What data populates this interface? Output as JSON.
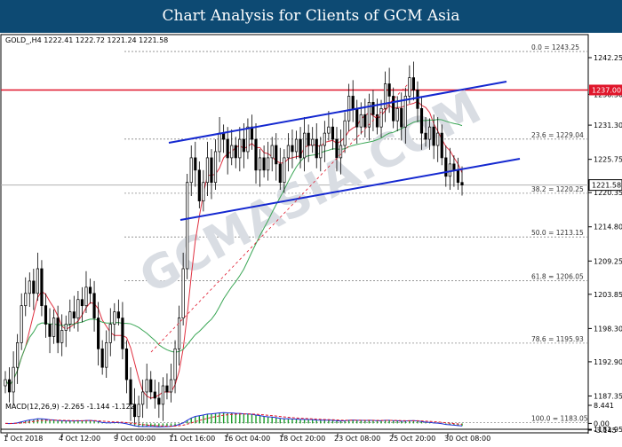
{
  "title": "Chart Analysis for Clients of GCM Asia",
  "chart_data": [
    {
      "type": "candlestick",
      "symbol_line": "GOLD_,H4  1222.41 1222.72 1221.24 1221.58",
      "y_ticks": [
        "1242.25",
        "1236.30",
        "1231.30",
        "1225.75",
        "1220.35",
        "1214.80",
        "1209.25",
        "1203.85",
        "1198.30",
        "1192.90",
        "1187.35",
        "1181.95"
      ],
      "y_values": [
        1242.25,
        1236.3,
        1231.3,
        1225.75,
        1220.35,
        1214.8,
        1209.25,
        1203.85,
        1198.3,
        1192.9,
        1187.35,
        1181.95
      ],
      "x_ticks": [
        "1 Oct 2018",
        "4 Oct 12:00",
        "9 Oct 00:00",
        "11 Oct 16:00",
        "16 Oct 04:00",
        "18 Oct 20:00",
        "23 Oct 08:00",
        "25 Oct 20:00",
        "30 Oct 08:00"
      ],
      "current_price": "1221.58",
      "resistance_level": "1237.00",
      "fibonacci": [
        {
          "label": "0.0 = 1243.25",
          "value": 1243.25
        },
        {
          "label": "23.6 = 1229.04",
          "value": 1229.04
        },
        {
          "label": "38.2 = 1220.25",
          "value": 1220.25
        },
        {
          "label": "50.0 = 1213.15",
          "value": 1213.15
        },
        {
          "label": "61.8 = 1206.05",
          "value": 1206.05
        },
        {
          "label": "78.6 = 1195.93",
          "value": 1195.93
        },
        {
          "label": "100.0 = 1183.05",
          "value": 1183.05
        }
      ],
      "closes": [
        1190,
        1188,
        1192,
        1196,
        1202,
        1204,
        1206,
        1204,
        1208,
        1202,
        1199,
        1197,
        1200,
        1196,
        1198,
        1199,
        1201,
        1200,
        1203,
        1202,
        1205,
        1204,
        1200,
        1195,
        1192,
        1196,
        1199,
        1201,
        1200,
        1195,
        1190,
        1186,
        1184,
        1186,
        1188,
        1190,
        1188,
        1187,
        1186,
        1189,
        1188,
        1190,
        1195,
        1200,
        1208,
        1222,
        1226,
        1224,
        1219,
        1222,
        1226,
        1222,
        1227,
        1230,
        1229,
        1226,
        1228,
        1226,
        1229,
        1227,
        1231,
        1229,
        1224,
        1226,
        1224,
        1226,
        1228,
        1225,
        1222,
        1226,
        1228,
        1227,
        1229,
        1226,
        1230,
        1228,
        1229,
        1226,
        1228,
        1230,
        1231,
        1229,
        1226,
        1228,
        1232,
        1236,
        1234,
        1231,
        1233,
        1231,
        1235,
        1233,
        1231,
        1234,
        1238,
        1236,
        1232,
        1234,
        1231,
        1236,
        1239,
        1237,
        1234,
        1230,
        1229,
        1231,
        1228,
        1230,
        1226,
        1223,
        1225,
        1224,
        1222,
        1221.58
      ],
      "support_channel_anchors": [
        [
          0.45,
          1219.35
        ],
        [
          0.84,
          1227.2
        ]
      ],
      "macd": {
        "label": "MACD(12,26,9) -2.265 -1.144 -1.122",
        "y_ticks": [
          "8.441",
          "0.00",
          "-3.145"
        ],
        "y_values": [
          8.441,
          0,
          -3.145
        ]
      }
    }
  ]
}
